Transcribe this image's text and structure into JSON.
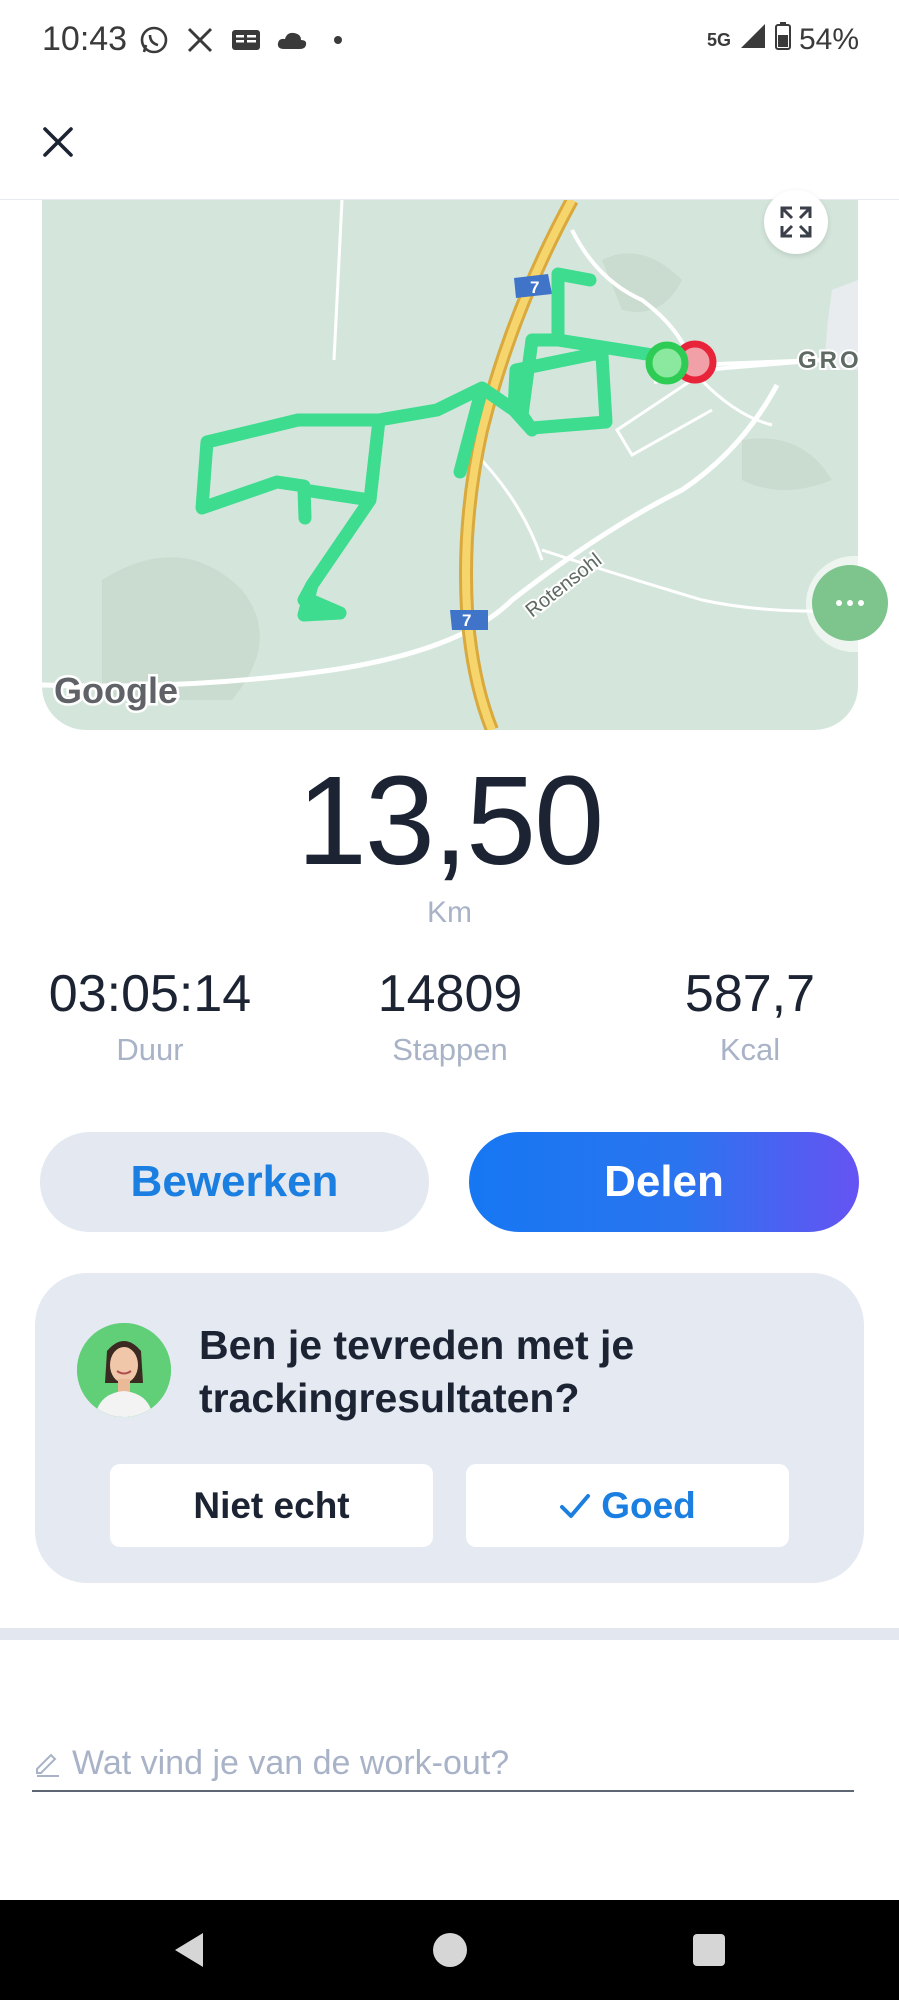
{
  "status_bar": {
    "time": "10:43",
    "network": "5G",
    "battery": "54%",
    "icons": [
      "whatsapp-icon",
      "x-icon",
      "news-icon",
      "cloud-icon",
      "dot-icon",
      "signal-icon",
      "battery-icon"
    ]
  },
  "top_bar": {
    "close_icon": "close-icon"
  },
  "map": {
    "road_label": "Rotensohl",
    "highway_number": "7",
    "place_label": "GRO",
    "provider": "Google",
    "route_color": "#3ddc8f",
    "start_color": "#2ecc55",
    "end_color": "#e8243a"
  },
  "workout": {
    "distance": "13,50",
    "distance_unit": "Km",
    "stats": [
      {
        "value": "03:05:14",
        "label": "Duur"
      },
      {
        "value": "14809",
        "label": "Stappen"
      },
      {
        "value": "587,7",
        "label": "Kcal"
      }
    ]
  },
  "actions": {
    "edit": "Bewerken",
    "share": "Delen"
  },
  "feedback": {
    "question": "Ben je tevreden met je trackingresultaten?",
    "no": "Niet echt",
    "yes": "Goed"
  },
  "comment": {
    "placeholder": "Wat vind je van de work-out?"
  },
  "colors": {
    "accent": "#1a7fe0",
    "card_bg": "#e4e9f2",
    "muted": "#a9b3c7"
  }
}
